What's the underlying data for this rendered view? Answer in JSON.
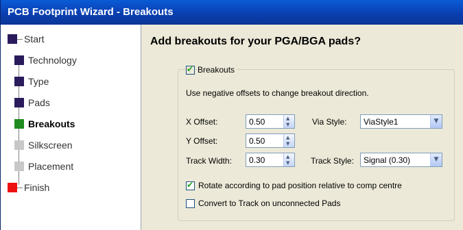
{
  "window": {
    "title": "PCB Footprint Wizard - Breakouts"
  },
  "steps": [
    {
      "label": "Start",
      "state": "terminal-start",
      "color": "#2a1b5c"
    },
    {
      "label": "Technology",
      "state": "done",
      "color": "#2a1b5c"
    },
    {
      "label": "Type",
      "state": "done",
      "color": "#2a1b5c"
    },
    {
      "label": "Pads",
      "state": "done",
      "color": "#2a1b5c"
    },
    {
      "label": "Breakouts",
      "state": "current",
      "color": "#1f8c1f"
    },
    {
      "label": "Silkscreen",
      "state": "pending",
      "color": "#c8c8c8"
    },
    {
      "label": "Placement",
      "state": "pending",
      "color": "#c8c8c8"
    },
    {
      "label": "Finish",
      "state": "terminal-finish",
      "color": "#ee1111"
    }
  ],
  "page": {
    "heading": "Add breakouts for your PGA/BGA pads?",
    "breakouts_checkbox": {
      "label": "Breakouts",
      "checked": true
    },
    "hint": "Use negative offsets to change breakout direction.",
    "x_offset": {
      "label": "X Offset:",
      "value": "0.50"
    },
    "y_offset": {
      "label": "Y Offset:",
      "value": "0.50"
    },
    "track_width": {
      "label": "Track Width:",
      "value": "0.30"
    },
    "via_style": {
      "label": "Via Style:",
      "value": "ViaStyle1"
    },
    "track_style": {
      "label": "Track Style:",
      "value": "Signal (0.30)"
    },
    "rotate_checkbox": {
      "label": "Rotate according to pad position relative to comp centre",
      "checked": true
    },
    "convert_checkbox": {
      "label": "Convert to Track on unconnected Pads",
      "checked": false
    }
  }
}
